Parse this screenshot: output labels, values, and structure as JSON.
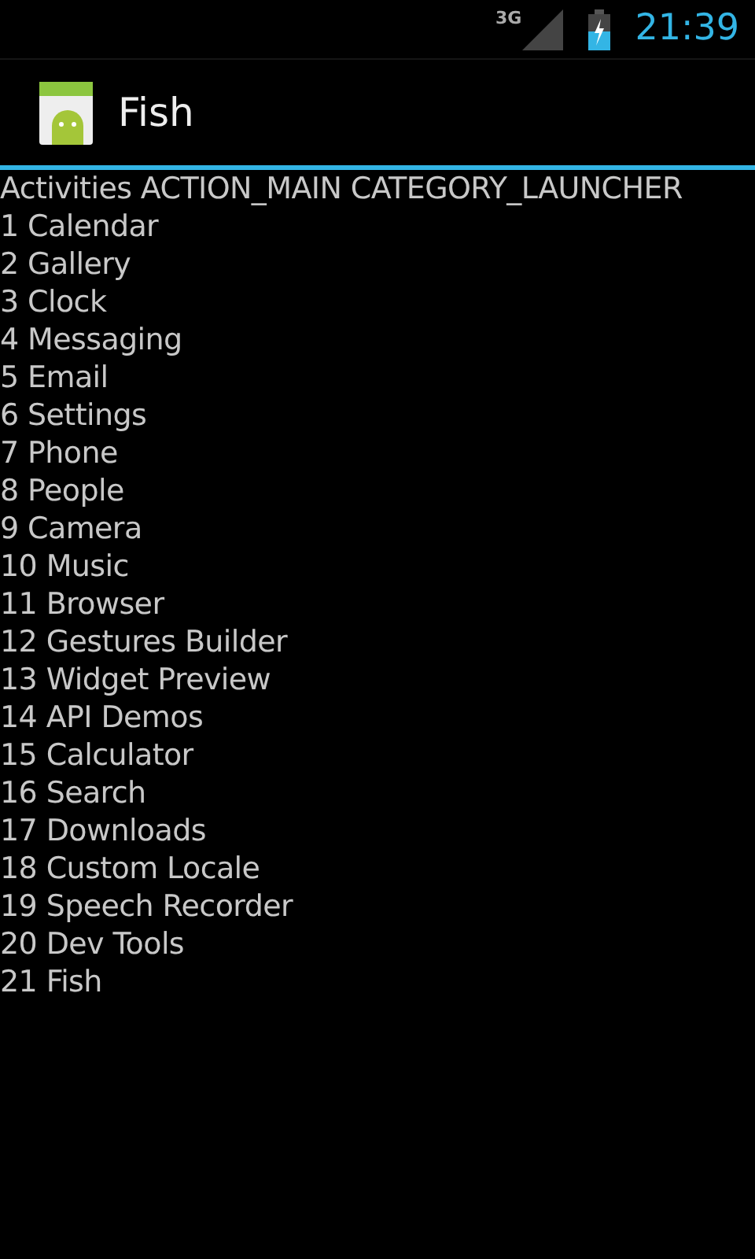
{
  "status_bar": {
    "network": "3G",
    "time": "21:39"
  },
  "action_bar": {
    "title": "Fish"
  },
  "list": {
    "header": "Activities ACTION_MAIN CATEGORY_LAUNCHER",
    "items": [
      "1 Calendar",
      "2 Gallery",
      "3 Clock",
      "4 Messaging",
      "5 Email",
      "6 Settings",
      "7 Phone",
      "8 People",
      "9 Camera",
      "10 Music",
      "11 Browser",
      "12 Gestures Builder",
      "13 Widget Preview",
      "14 API Demos",
      "15 Calculator",
      "16 Search",
      "17 Downloads",
      "18 Custom Locale",
      "19 Speech Recorder",
      "20 Dev Tools",
      "21 Fish"
    ]
  }
}
